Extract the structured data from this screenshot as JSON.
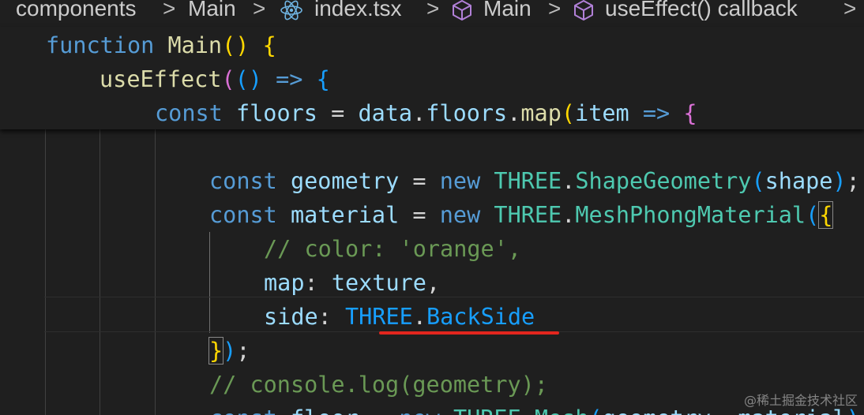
{
  "breadcrumb": {
    "items": [
      "components",
      "Main",
      "index.tsx",
      "Main",
      "useEffect() callback"
    ],
    "separator": ">"
  },
  "sticky": {
    "l1": {
      "kw": "function",
      "name": "Main",
      "paren": "()",
      "brace": "{"
    },
    "l2": {
      "fn": "useEffect",
      "open": "(",
      "args": "()",
      "arrow": "=>",
      "brace": "{"
    },
    "l3": {
      "kw": "const",
      "var": "floors",
      "eq": "=",
      "obj": "data",
      "dot1": ".",
      "prop": "floors",
      "dot2": ".",
      "method": "map",
      "paren": "(",
      "param": "item",
      "arrow": "=>",
      "brace": "{"
    }
  },
  "code": {
    "l1": {
      "kw": "const",
      "var": "geometry",
      "eq": "=",
      "new": "new",
      "ns": "THREE",
      "dot": ".",
      "cls": "ShapeGeometry",
      "open": "(",
      "arg": "shape",
      "close": ")",
      "semi": ";"
    },
    "l2": {
      "kw": "const",
      "var": "material",
      "eq": "=",
      "new": "new",
      "ns": "THREE",
      "dot": ".",
      "cls": "MeshPhongMaterial",
      "open": "(",
      "brace": "{"
    },
    "l3": {
      "comment": "// color: 'orange',"
    },
    "l4": {
      "key": "map",
      "colon": ":",
      "value": "texture",
      "comma": ","
    },
    "l5": {
      "key": "side",
      "colon": ":",
      "ns": "THREE",
      "dot": ".",
      "value": "BackSide"
    },
    "l6": {
      "brace": "}",
      "close": ")",
      "semi": ";"
    },
    "l7": {
      "comment": "// console.log(geometry);"
    },
    "l8": {
      "kw": "const",
      "var": "floor",
      "eq": "=",
      "new": "new",
      "ns": "THREE",
      "dot": ".",
      "cls": "Mesh",
      "open": "(",
      "args": "geometry, material",
      "close": ")"
    }
  },
  "watermark": "@稀土掘金技术社区",
  "colors": {
    "background": "#1f1f1f",
    "keyword": "#569cd6",
    "function": "#dcdcaa",
    "class": "#4ec9b0",
    "variable": "#9cdcfe",
    "comment": "#6a9955",
    "underline": "#e3261e"
  }
}
